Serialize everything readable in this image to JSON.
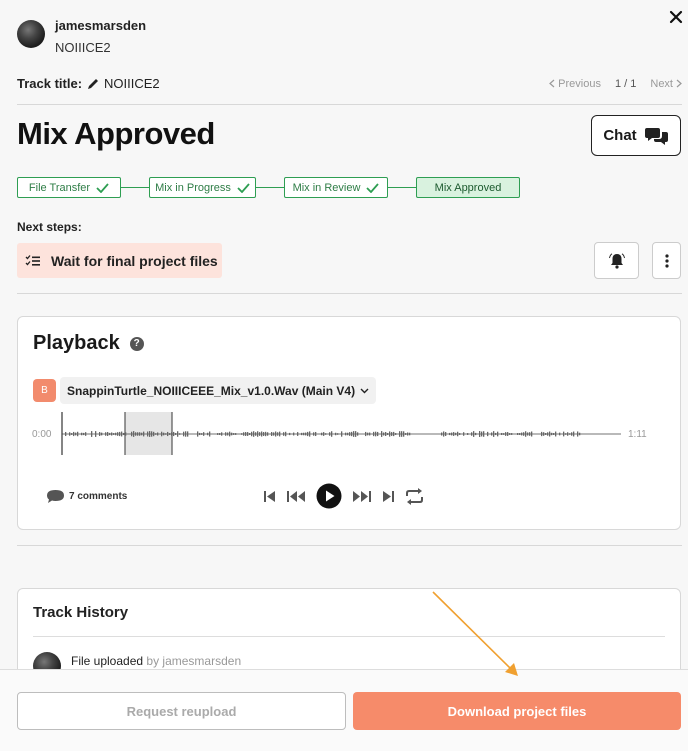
{
  "header": {
    "username": "jamesmarsden",
    "track_subtitle": "NOIIICE2"
  },
  "track": {
    "label": "Track title:",
    "title": "NOIIICE2",
    "pager": {
      "previous": "Previous",
      "count": "1 / 1",
      "next": "Next"
    }
  },
  "status": {
    "title": "Mix Approved",
    "chat_label": "Chat"
  },
  "steps": [
    {
      "label": "File Transfer",
      "done": true
    },
    {
      "label": "Mix in Progress",
      "done": true
    },
    {
      "label": "Mix in Review",
      "done": true
    },
    {
      "label": "Mix Approved",
      "done": false,
      "active": true
    }
  ],
  "next_steps": {
    "label": "Next steps:",
    "item": "Wait for final project files"
  },
  "playback": {
    "title": "Playback",
    "help": "?",
    "version_badge": "B",
    "file_name": "SnappinTurtle_NOIIICEEE_Mix_v1.0.Wav (Main V4)",
    "time_start": "0:00",
    "time_end": "1:11",
    "comments": "7 comments"
  },
  "history": {
    "title": "Track History",
    "item_action": "File uploaded",
    "item_by": "by jamesmarsden"
  },
  "footer": {
    "reupload_label": "Request reupload",
    "download_label": "Download project files"
  },
  "colors": {
    "accent": "#f68b6a",
    "step_green": "#2e9e52",
    "next_chip": "#fde3dc"
  }
}
